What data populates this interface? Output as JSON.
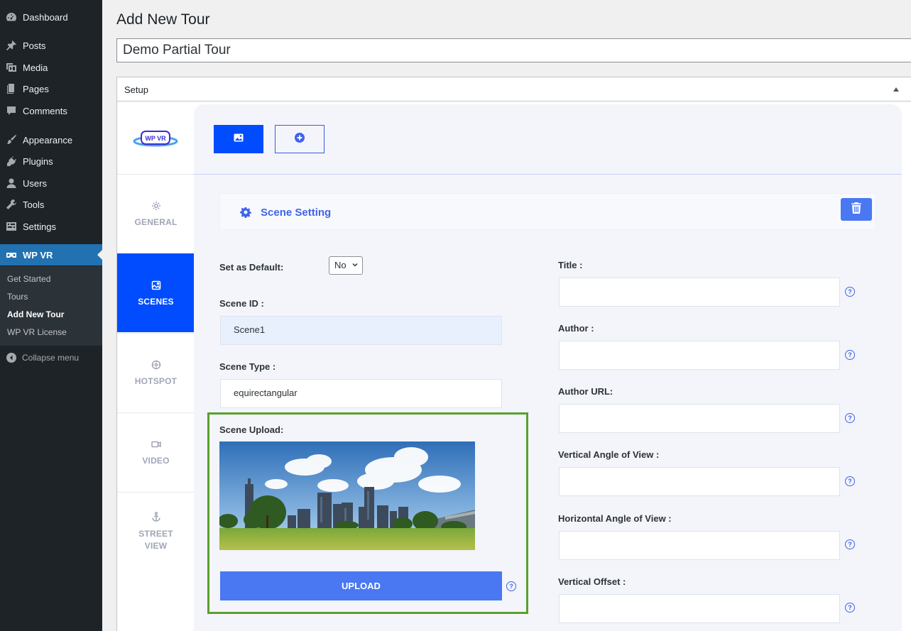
{
  "admin_menu": {
    "items": [
      {
        "label": "Dashboard",
        "icon": "dashboard-icon"
      },
      {
        "label": "Posts",
        "icon": "pin-icon"
      },
      {
        "label": "Media",
        "icon": "media-icon"
      },
      {
        "label": "Pages",
        "icon": "pages-icon"
      },
      {
        "label": "Comments",
        "icon": "comment-icon"
      },
      {
        "label": "Appearance",
        "icon": "brush-icon"
      },
      {
        "label": "Plugins",
        "icon": "plugin-icon"
      },
      {
        "label": "Users",
        "icon": "user-icon"
      },
      {
        "label": "Tools",
        "icon": "wrench-icon"
      },
      {
        "label": "Settings",
        "icon": "settings-icon"
      },
      {
        "label": "WP VR",
        "icon": "vr-icon"
      }
    ],
    "submenu": [
      "Get Started",
      "Tours",
      "Add New Tour",
      "WP VR License"
    ],
    "collapse_label": "Collapse menu"
  },
  "page": {
    "heading": "Add New Tour",
    "title_value": "Demo Partial Tour"
  },
  "metabox": {
    "title": "Setup"
  },
  "vr": {
    "logo_text": "WP VR",
    "tabs": [
      "GENERAL",
      "SCENES",
      "HOTSPOT",
      "VIDEO",
      "STREET VIEW"
    ],
    "active_tab": "SCENES",
    "scene_setting_label": "Scene Setting",
    "fields": {
      "default_label": "Set as Default:",
      "default_value": "No",
      "scene_id_label": "Scene ID :",
      "scene_id_value": "Scene1",
      "scene_type_label": "Scene Type :",
      "scene_type_value": "equirectangular",
      "scene_upload_label": "Scene Upload:",
      "upload_button": "UPLOAD",
      "title_label": "Title :",
      "author_label": "Author :",
      "author_url_label": "Author URL:",
      "vaov_label": "Vertical Angle of View :",
      "haov_label": "Horizontal Angle of View :",
      "voffset_label": "Vertical Offset :"
    },
    "help_glyph": "?"
  },
  "colors": {
    "wp_sidebar": "#1d2327",
    "wp_current": "#2271b1",
    "vr_blue": "#004cfe",
    "button_blue": "#4978f2",
    "highlight_green": "#5aa02c"
  }
}
